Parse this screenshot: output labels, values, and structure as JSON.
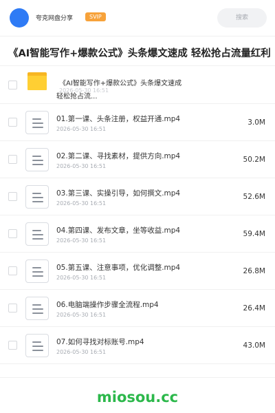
{
  "header": {
    "username": "夸克网盘分享",
    "badge": "SVIP",
    "search_placeholder": "搜索",
    "avatar_color": "#2f7bf5",
    "badge_color": "#f7a23a"
  },
  "share_title": "《AI智能写作+爆款公式》头条爆文速成 轻松抢占流量红利",
  "folder": {
    "name_line1": "《AI智能写作+爆款公式》头条爆文速成",
    "name_line2": "轻松抢占流...",
    "date": "2026-05-30 16:51",
    "icon": "folder-icon"
  },
  "files": [
    {
      "name": "01.第一课、头条注册，权益开通.mp4",
      "date": "2026-05-30 16:51",
      "size": "3.0M",
      "icon": "document-icon"
    },
    {
      "name": "02.第二课、寻找素材，提供方向.mp4",
      "date": "2026-05-30 16:51",
      "size": "50.2M",
      "icon": "document-icon"
    },
    {
      "name": "03.第三课、实操引导，如何撰文.mp4",
      "date": "2026-05-30 16:51",
      "size": "52.6M",
      "icon": "document-icon"
    },
    {
      "name": "04.第四课、发布文章，坐等收益.mp4",
      "date": "2026-05-30 16:51",
      "size": "59.4M",
      "icon": "document-icon"
    },
    {
      "name": "05.第五课、注意事项，优化调整.mp4",
      "date": "2026-05-30 16:51",
      "size": "26.8M",
      "icon": "document-icon"
    },
    {
      "name": "06.电脑端操作步骤全流程.mp4",
      "date": "2026-05-30 16:51",
      "size": "26.4M",
      "icon": "document-icon"
    },
    {
      "name": "07.如何寻找对标账号.mp4",
      "date": "2026-05-30 16:51",
      "size": "43.0M",
      "icon": "document-icon"
    }
  ],
  "watermark": "miosou.cc"
}
